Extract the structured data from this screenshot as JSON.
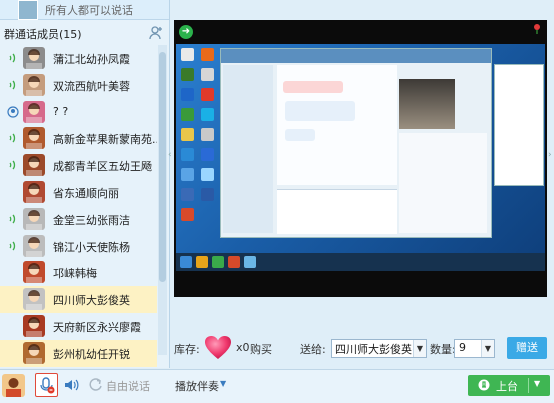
{
  "left_panel": {
    "top_text": "所有人都可以说话",
    "members_header": "群通话成员(15)",
    "members": [
      {
        "name": "蒲江北幼孙凤霞",
        "mic": "speaker",
        "avatar_color": "#8c8c8c"
      },
      {
        "name": "双流西航叶美蓉",
        "mic": "speaker",
        "avatar_color": "#c49c7d"
      },
      {
        "name": "? ?",
        "mic": "user",
        "avatar_color": "#d66a8b"
      },
      {
        "name": "高新金苹果新蒙南苑...",
        "mic": "speaker",
        "avatar_color": "#b05a2e"
      },
      {
        "name": "成都青羊区五幼王飏",
        "mic": "speaker",
        "avatar_color": "#9c4a2a"
      },
      {
        "name": "省东通顺向丽",
        "mic": "none",
        "avatar_color": "#b04a32"
      },
      {
        "name": "金堂三幼张雨洁",
        "mic": "speaker",
        "avatar_color": "#b8b8b8"
      },
      {
        "name": "锦江小天使陈杨",
        "mic": "speaker",
        "avatar_color": "#bcbcbc"
      },
      {
        "name": "邛崃韩梅",
        "mic": "none",
        "avatar_color": "#c04a2c"
      },
      {
        "name": "四川师大彭俊英",
        "mic": "none",
        "avatar_color": "#c2c2c2",
        "selected": true
      },
      {
        "name": "天府新区永兴廖霞",
        "mic": "none",
        "avatar_color": "#a83a22"
      },
      {
        "name": "彭州机幼任开锐",
        "mic": "none",
        "avatar_color": "#b06a30",
        "selected": true
      }
    ]
  },
  "gift": {
    "inventory_label": "库存:",
    "count": "x0",
    "buy": "购买",
    "send_to_label": "送给:",
    "recipient": "四川师大彭俊英(",
    "qty_label": "数量:",
    "qty": "9",
    "give_button": "赠送"
  },
  "bottom": {
    "free_talk": "自由说话",
    "accompaniment": "播放伴奏",
    "onstage": "上台"
  },
  "colors": {
    "accent_green": "#3fb653",
    "accent_blue": "#3aa9e6",
    "selected_row": "#fdf2c4"
  }
}
